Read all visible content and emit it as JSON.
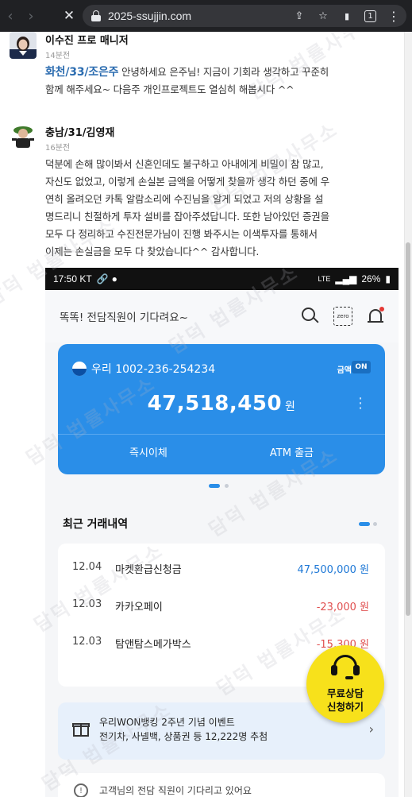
{
  "browser": {
    "back_icon": "back-arrow-icon",
    "forward_icon": "forward-arrow-icon",
    "reload_icon": "close-icon",
    "url": "2025-ssujjin.com",
    "tab_count": "1"
  },
  "comments": [
    {
      "author": "이수진 프로 매니저",
      "time": "14분전",
      "mention": "화천/33/조은주",
      "text_line1": " 안녕하세요 은주님! 지금이 기회라 생각하고 꾸준히",
      "text_line2": "함께 해주세요~ 다음주 개인프로젝트도 열심히 해봅시다 ^^"
    },
    {
      "author": "충남/31/김영재",
      "time": "16분전",
      "lines": [
        "덕분에 손해 많이봐서 신혼인데도 불구하고 아내에게 비밀이 참 많고,",
        "자신도 없었고, 이렇게 손실본 금액을 어떻게 찾을까 생각 하던 중에 우",
        "연히 올려오던 카톡 알람소리에 수진님을 알게 되었고 저의 상황을 설",
        "명드리니 친절하게 투자 설비를 잡아주셨답니다. 또한 남아있던 증권을",
        "모두 다 정리하고 수진전문가님이 진행 봐주시는 이색투자를 통해서",
        "이제는 손실금을 모두 다 찾았습니다^^ 감사합니다."
      ]
    }
  ],
  "phone": {
    "status_time": "17:50 KT",
    "status_right": "LTE",
    "battery": "26%",
    "app_title": "똑똑! 전담직원이 기다려요~",
    "zero_label": "zero",
    "account_number": "우리 1002-236-254234",
    "balance_label": "금액",
    "toggle_label": "ON",
    "balance": "47,518,450",
    "balance_unit": "원",
    "btn_transfer": "즉시이체",
    "btn_atm": "ATM 출금",
    "tx_title": "최근 거래내역",
    "transactions": [
      {
        "date": "12.04",
        "desc": "마켓환급신청금",
        "amount": "47,500,000 원",
        "type": "in"
      },
      {
        "date": "12.03",
        "desc": "카카오페이",
        "amount": "-23,000 원",
        "type": "out"
      },
      {
        "date": "12.03",
        "desc": "탐앤탐스메가박스",
        "amount": "-15,300 원",
        "type": "out"
      }
    ],
    "promo_line1": "우리WON뱅킹 2주년 기념 이벤트",
    "promo_line2": "전기차, 사넬백, 상품권 등 12,222명 추첨",
    "notice_text": "고객님의 전담 직원이 기다리고 있어요"
  },
  "watermark_text": "담덕 법률사무소",
  "consult": {
    "line1": "무료상담",
    "line2": "신청하기",
    "icon": "headset-icon"
  },
  "colors": {
    "card_blue": "#2a8ee8",
    "income_blue": "#1e78d6",
    "expense_red": "#e05050",
    "consult_yellow": "#f7e11b",
    "mention_blue": "#2b6cb0"
  }
}
